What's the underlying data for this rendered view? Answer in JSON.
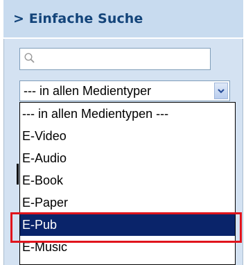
{
  "header": {
    "title": "> Einfache Suche"
  },
  "search": {
    "placeholder": ""
  },
  "media_select": {
    "selected": "--- in allen Medientyper",
    "options": [
      "--- in allen Medientypen ---",
      "E-Video",
      "E-Audio",
      "E-Book",
      "E-Paper",
      "E-Pub",
      "E-Music"
    ],
    "highlighted_index": 5
  },
  "colors": {
    "panel_bg": "#d4e2f2",
    "title": "#13447a",
    "selection": "#0a246a",
    "callout": "#e0141c"
  },
  "icons": {
    "search": "magnifier-icon",
    "dropdown": "chevron-down-icon"
  }
}
